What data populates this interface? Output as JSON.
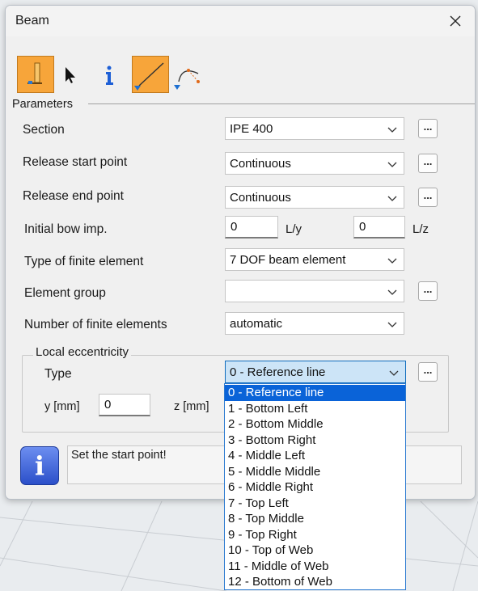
{
  "window": {
    "title": "Beam"
  },
  "toolbar": {
    "icons": [
      "beam-tool-icon",
      "select-arrow-icon",
      "info-icon",
      "straight-beam-icon",
      "arc-beam-icon"
    ]
  },
  "parameters": {
    "legend": "Parameters",
    "rows": [
      {
        "label": "Section",
        "value": "IPE 400"
      },
      {
        "label": "Release start point",
        "value": "Continuous"
      },
      {
        "label": "Release end point",
        "value": "Continuous"
      },
      {
        "label": "Initial bow imp.",
        "value_y": "0",
        "unit_y": "L/y",
        "value_z": "0",
        "unit_z": "L/z"
      },
      {
        "label": "Type of finite element",
        "value": "7 DOF beam element"
      },
      {
        "label": "Element group",
        "value": ""
      },
      {
        "label": "Number of finite elements",
        "value": "automatic"
      }
    ]
  },
  "eccentricity": {
    "legend": "Local eccentricity",
    "type_label": "Type",
    "type_value": "0 - Reference line",
    "y_label": "y [mm]",
    "y_value": "0",
    "z_label": "z [mm]"
  },
  "message": {
    "text": "Set the start point!"
  },
  "ellipsis": "...",
  "dropdown": {
    "selected_index": 0,
    "options": [
      "0 - Reference line",
      "1 - Bottom Left",
      "2 - Bottom Middle",
      "3 - Bottom Right",
      "4 - Middle Left",
      "5 - Middle Middle",
      "6 - Middle Right",
      "7 - Top Left",
      "8 - Top Middle",
      "9 - Top Right",
      "10 - Top of Web",
      "11 - Middle of Web",
      "12 - Bottom of Web"
    ]
  },
  "colors": {
    "accent_orange": "#f7a53a",
    "selection_blue": "#0a63d8",
    "active_combo": "#cce4f7"
  }
}
